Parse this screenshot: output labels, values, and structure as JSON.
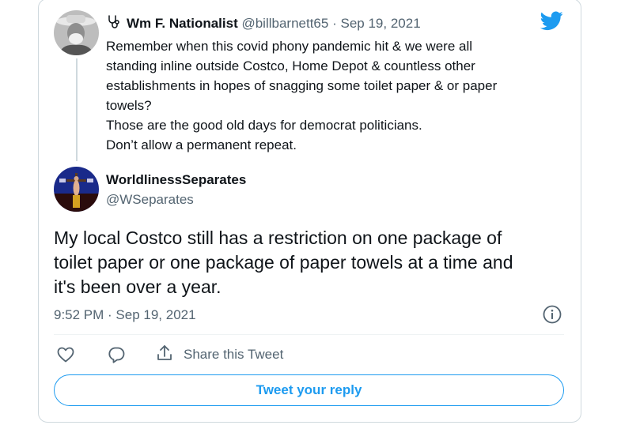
{
  "quoted_tweet": {
    "author_name": "Wm F. Nationalist",
    "handle": "@billbarnett65",
    "separator": "·",
    "date": "Sep 19, 2021",
    "lines": [
      "Remember when this covid phony pandemic hit & we were all",
      "standing inline outside Costco, Home Depot & countless other",
      "establishments in hopes of snagging some toilet paper & or paper",
      "towels?",
      "Those are the good old days for democrat politicians.",
      "Don’t allow a permanent repeat."
    ]
  },
  "reply_tweet": {
    "author_name": "WorldlinessSeparates",
    "handle": "@WSeparates",
    "lines": [
      "My local Costco still has a restriction on one package of",
      "toilet paper or one package of paper towels at a time and",
      "it's been over a year."
    ],
    "timestamp": "9:52 PM · Sep 19, 2021"
  },
  "actions": {
    "share_label": "Share this Tweet",
    "reply_button_label": "Tweet your reply"
  },
  "icons": [
    "stethoscope-icon",
    "twitter-logo-icon",
    "info-icon",
    "heart-icon",
    "reply-icon",
    "share-icon"
  ],
  "colors": {
    "accent": "#1d9bf0",
    "secondary_text": "#536471",
    "border": "#cfd9de"
  }
}
